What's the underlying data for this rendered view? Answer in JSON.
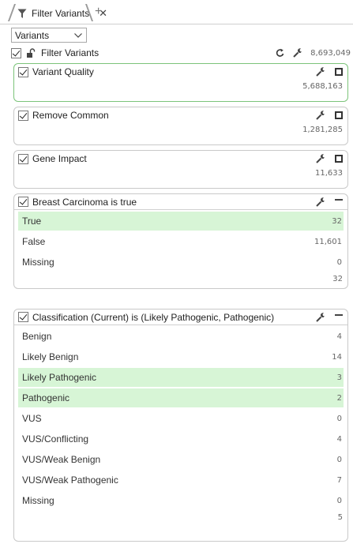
{
  "tab": {
    "title": "Filter Variants",
    "close": "✕",
    "add": "+"
  },
  "dropdown": {
    "value": "Variants"
  },
  "root": {
    "label": "Filter Variants",
    "count": "8,693,049"
  },
  "cards": [
    {
      "title": "Variant Quality",
      "count": "5,688,163"
    },
    {
      "title": "Remove Common",
      "count": "1,281,285"
    },
    {
      "title": "Gene Impact",
      "count": "11,633"
    }
  ],
  "breast": {
    "title": "Breast Carcinoma is true",
    "options": [
      {
        "label": "True",
        "count": "32",
        "selected": true
      },
      {
        "label": "False",
        "count": "11,601",
        "selected": false
      },
      {
        "label": "Missing",
        "count": "0",
        "selected": false
      }
    ],
    "total": "32"
  },
  "classification": {
    "title": "Classification (Current) is (Likely Pathogenic, Pathogenic)",
    "options": [
      {
        "label": "Benign",
        "count": "4",
        "selected": false
      },
      {
        "label": "Likely Benign",
        "count": "14",
        "selected": false
      },
      {
        "label": "Likely Pathogenic",
        "count": "3",
        "selected": true
      },
      {
        "label": "Pathogenic",
        "count": "2",
        "selected": true
      },
      {
        "label": "VUS",
        "count": "0",
        "selected": false
      },
      {
        "label": "VUS/Conflicting",
        "count": "4",
        "selected": false
      },
      {
        "label": "VUS/Weak Benign",
        "count": "0",
        "selected": false
      },
      {
        "label": "VUS/Weak Pathogenic",
        "count": "7",
        "selected": false
      },
      {
        "label": "Missing",
        "count": "0",
        "selected": false
      }
    ],
    "total": "5"
  },
  "colors": {
    "active_border": "#7cc47a",
    "selected_bg": "#d7f5d6"
  },
  "icons": {
    "tab": "funnel-icon",
    "lock": "unlock-icon",
    "refresh": "refresh-icon",
    "settings": "wrench-icon",
    "expand": "square-icon",
    "collapse": "minus-icon"
  }
}
